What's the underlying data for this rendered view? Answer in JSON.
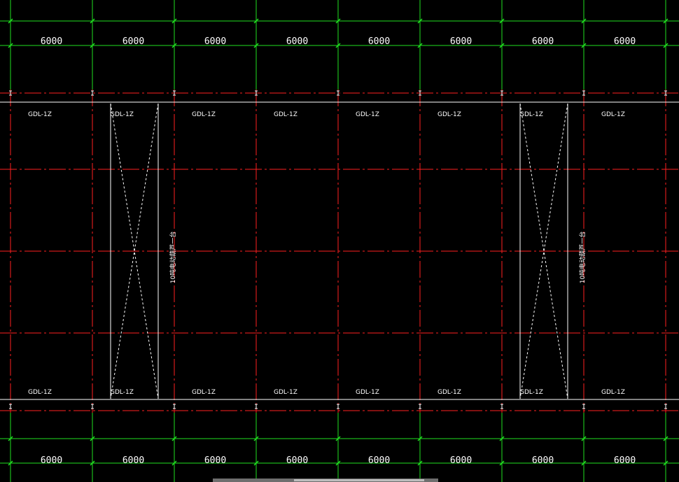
{
  "drawing": {
    "background": "#000000",
    "grid_color": "#ff2020",
    "dim_line_color": "#20e020",
    "beam_color": "#ffffff",
    "top_dimensions": [
      "6000",
      "6000",
      "6000",
      "6000",
      "6000",
      "6000",
      "6000",
      "6000"
    ],
    "bottom_dimensions": [
      "6000",
      "6000",
      "6000",
      "6000",
      "6000",
      "6000",
      "6000",
      "6000"
    ],
    "top_beam_labels": [
      "GDL-1Z",
      "GDL-1Z",
      "GDL-1Z",
      "GDL-1Z",
      "GDL-1Z",
      "GDL-1Z",
      "GDL-1Z",
      "GDL-1Z"
    ],
    "bottom_beam_labels": [
      "GDL-1Z",
      "GDL-1Z",
      "GDL-1Z",
      "GDL-1Z",
      "GDL-1Z",
      "GDL-1Z",
      "GDL-1Z",
      "GDL-1Z"
    ],
    "crane_label": "10吨电动葫芦一台",
    "crane_bays": [
      1,
      6
    ]
  }
}
